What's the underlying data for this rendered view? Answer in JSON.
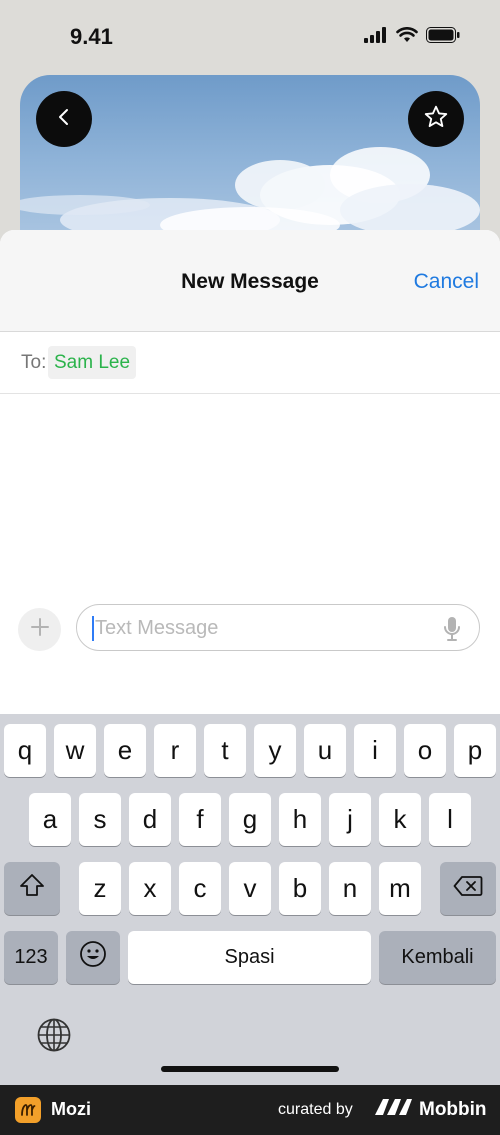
{
  "status_bar": {
    "time": "9.41",
    "icons": [
      "signal-icon",
      "wifi-icon",
      "battery-icon"
    ]
  },
  "hero": {
    "buttons": [
      "back-icon",
      "star-icon"
    ]
  },
  "compose_sheet": {
    "title": "New Message",
    "cancel_label": "Cancel",
    "to_label": "To:",
    "recipient": "Sam Lee",
    "message_placeholder": "Text Message",
    "colors": {
      "accent": "#1f7ae0",
      "recipient": "#2bb34b"
    }
  },
  "keyboard": {
    "row1": [
      "q",
      "w",
      "e",
      "r",
      "t",
      "y",
      "u",
      "i",
      "o",
      "p"
    ],
    "row2": [
      "a",
      "s",
      "d",
      "f",
      "g",
      "h",
      "j",
      "k",
      "l"
    ],
    "row3": [
      "z",
      "x",
      "c",
      "v",
      "b",
      "n",
      "m"
    ],
    "numbers_label": "123",
    "space_label": "Spasi",
    "return_label": "Kembali",
    "icons": [
      "shift-icon",
      "delete-icon",
      "emoji-icon",
      "globe-icon"
    ]
  },
  "footer": {
    "app_name": "Mozi",
    "curated_label": "curated by",
    "brand_name": "Mobbin"
  }
}
